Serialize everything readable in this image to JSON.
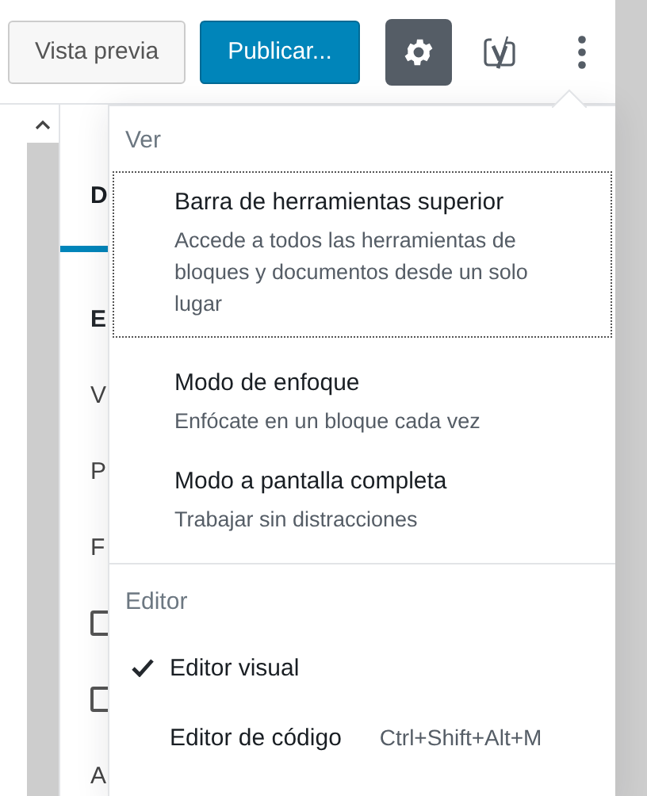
{
  "toolbar": {
    "buttons": [
      {
        "label": "Vista previa",
        "kind": "secondary"
      },
      {
        "label": "Publicar...",
        "kind": "primary"
      }
    ],
    "icon_buttons": [
      {
        "kind": "settings",
        "selected": true
      },
      {
        "kind": "yoast",
        "selected": false
      },
      {
        "kind": "more",
        "selected": false
      }
    ]
  },
  "sidebar": {
    "tab": {
      "label": "D",
      "selected": true
    },
    "rows": [
      {
        "kind": "heading",
        "text": "E"
      },
      {
        "kind": "text",
        "text": "V"
      },
      {
        "kind": "text",
        "text": "P"
      },
      {
        "kind": "text",
        "text": "F"
      },
      {
        "kind": "checkbox",
        "checked": false
      },
      {
        "kind": "checkbox",
        "checked": false
      },
      {
        "kind": "text",
        "text": "A"
      }
    ]
  },
  "menu": {
    "sections": [
      {
        "title": "Ver",
        "items": [
          {
            "label": "Barra de herramientas superior",
            "description": "Accede a todos las herramientas de bloques y documentos desde un solo lugar",
            "focused": true
          },
          {
            "label": "Modo de enfoque",
            "description": "Enfócate en un bloque cada vez",
            "focused": false
          },
          {
            "label": "Modo a pantalla completa",
            "description": "Trabajar sin distracciones",
            "focused": false
          }
        ]
      },
      {
        "title": "Editor",
        "items": [
          {
            "label": "Editor visual",
            "checked": true
          },
          {
            "label": "Editor de código",
            "shortcut": "Ctrl+Shift+Alt+M",
            "checked": false
          }
        ]
      }
    ]
  }
}
